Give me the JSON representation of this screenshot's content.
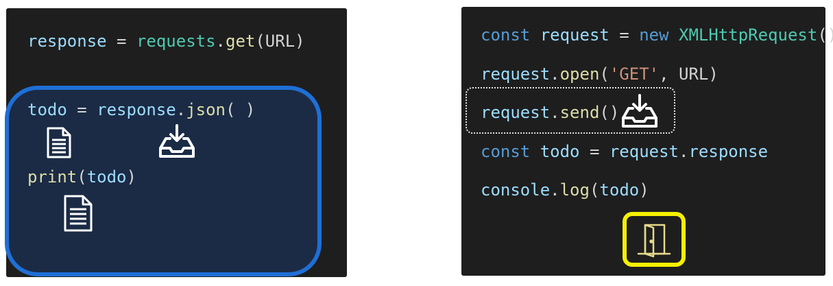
{
  "left_panel": {
    "lines": [
      {
        "name": "code-line-response",
        "tokens": [
          {
            "text": "response",
            "cls": "var"
          },
          {
            "text": " = ",
            "cls": "punc"
          },
          {
            "text": "requests",
            "cls": "mod"
          },
          {
            "text": ".",
            "cls": "punc"
          },
          {
            "text": "get",
            "cls": "fn"
          },
          {
            "text": "(URL)",
            "cls": "plain"
          }
        ]
      },
      {
        "name": "code-line-todo",
        "tokens": [
          {
            "text": "todo",
            "cls": "var"
          },
          {
            "text": " = ",
            "cls": "punc"
          },
          {
            "text": "response",
            "cls": "var"
          },
          {
            "text": ".",
            "cls": "punc"
          },
          {
            "text": "json",
            "cls": "fn"
          },
          {
            "text": "( )",
            "cls": "plain"
          }
        ]
      },
      {
        "name": "code-line-print",
        "tokens": [
          {
            "text": "print",
            "cls": "fn"
          },
          {
            "text": "(",
            "cls": "plain"
          },
          {
            "text": "todo",
            "cls": "var"
          },
          {
            "text": ")",
            "cls": "plain"
          }
        ]
      }
    ]
  },
  "right_panel": {
    "lines": [
      {
        "name": "code-line-const-request",
        "tokens": [
          {
            "text": "const",
            "cls": "kw"
          },
          {
            "text": " ",
            "cls": "plain"
          },
          {
            "text": "request",
            "cls": "var"
          },
          {
            "text": " = ",
            "cls": "punc"
          },
          {
            "text": "new",
            "cls": "kw"
          },
          {
            "text": " ",
            "cls": "plain"
          },
          {
            "text": "XMLHttpRequest",
            "cls": "cls"
          },
          {
            "text": "()",
            "cls": "plain"
          }
        ]
      },
      {
        "name": "code-line-open",
        "tokens": [
          {
            "text": "request",
            "cls": "var"
          },
          {
            "text": ".",
            "cls": "punc"
          },
          {
            "text": "open",
            "cls": "fn"
          },
          {
            "text": "(",
            "cls": "plain"
          },
          {
            "text": "'GET'",
            "cls": "str"
          },
          {
            "text": ", URL)",
            "cls": "plain"
          }
        ]
      },
      {
        "name": "code-line-send",
        "tokens": [
          {
            "text": "request",
            "cls": "var"
          },
          {
            "text": ".",
            "cls": "punc"
          },
          {
            "text": "send",
            "cls": "fn"
          },
          {
            "text": "()",
            "cls": "plain"
          }
        ]
      },
      {
        "name": "code-line-const-todo",
        "tokens": [
          {
            "text": "const",
            "cls": "kw"
          },
          {
            "text": " ",
            "cls": "plain"
          },
          {
            "text": "todo",
            "cls": "var"
          },
          {
            "text": " = ",
            "cls": "punc"
          },
          {
            "text": "request",
            "cls": "var"
          },
          {
            "text": ".",
            "cls": "punc"
          },
          {
            "text": "response",
            "cls": "var"
          }
        ]
      },
      {
        "name": "code-line-console-log",
        "tokens": [
          {
            "text": "console",
            "cls": "var"
          },
          {
            "text": ".",
            "cls": "punc"
          },
          {
            "text": "log",
            "cls": "fn"
          },
          {
            "text": "(",
            "cls": "plain"
          },
          {
            "text": "todo",
            "cls": "var"
          },
          {
            "text": ")",
            "cls": "plain"
          }
        ]
      }
    ]
  },
  "icons": {
    "download_tray": "inbox-download-icon",
    "document": "document-icon",
    "door": "open-door-icon"
  },
  "colors": {
    "panel_bg": "#1e1e1e",
    "blue_highlight": "#1f6fd6",
    "yellow_highlight": "#f5f000"
  }
}
